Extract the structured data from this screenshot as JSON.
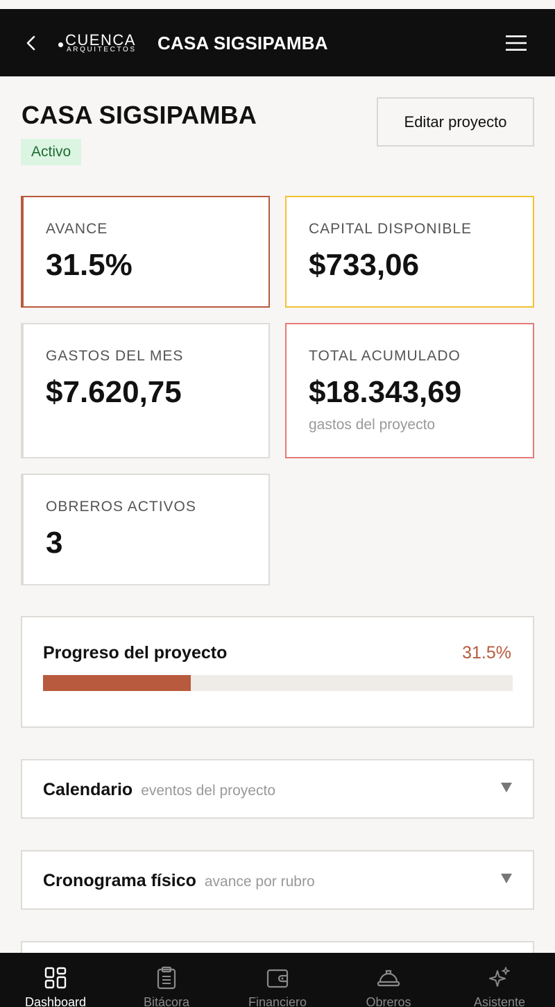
{
  "header": {
    "logo_main": "CUENCA",
    "logo_sub": "ARQUITECTOS",
    "title": "CASA SIGSIPAMBA"
  },
  "project": {
    "title": "CASA SIGSIPAMBA",
    "status": "Activo",
    "edit_label": "Editar proyecto"
  },
  "stats": {
    "avance": {
      "label": "AVANCE",
      "value": "31.5%"
    },
    "capital": {
      "label": "CAPITAL DISPONIBLE",
      "value": "$733,06"
    },
    "gastos_mes": {
      "label": "GASTOS DEL MES",
      "value": "$7.620,75"
    },
    "total": {
      "label": "TOTAL ACUMULADO",
      "value": "$18.343,69",
      "note": "gastos del proyecto"
    },
    "obreros": {
      "label": "OBREROS ACTIVOS",
      "value": "3"
    }
  },
  "progress": {
    "title": "Progreso del proyecto",
    "percent_label": "31.5%",
    "fraction": 0.315
  },
  "sections": {
    "calendario": {
      "title": "Calendario",
      "subtitle": "eventos del proyecto"
    },
    "cronograma": {
      "title": "Cronograma físico",
      "subtitle": "avance por rubro"
    }
  },
  "nav": {
    "dashboard": "Dashboard",
    "bitacora": "Bitácora",
    "financiero": "Financiero",
    "obreros": "Obreros",
    "asistente": "Asistente"
  },
  "colors": {
    "accent": "#b85a3d",
    "capital_border": "#f2c230",
    "total_border": "#e57b7b",
    "badge_bg": "#dcf5e2",
    "badge_text": "#1e6b35"
  },
  "icons": {
    "back": "chevron-left-icon",
    "menu": "hamburger-menu-icon",
    "caret": "triangle-down-icon"
  }
}
